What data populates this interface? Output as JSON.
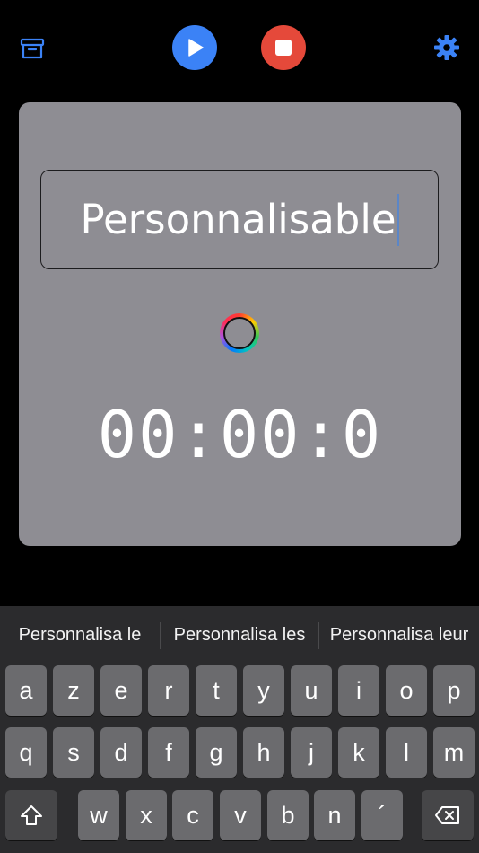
{
  "toolbar": {
    "archive_icon": "archive-box-icon",
    "play_icon": "play-icon",
    "stop_icon": "stop-icon",
    "settings_icon": "gear-icon",
    "accent_color": "#3b82f6",
    "play_color": "#3b82f6",
    "stop_color": "#e5493a"
  },
  "card": {
    "background": "#8e8d93",
    "name_value": "Personnalisable",
    "color_picker_icon": "color-wheel-icon",
    "timer_value": "00:00:0"
  },
  "keyboard": {
    "suggestions": [
      "Personnalisa le",
      "Personnalisa les",
      "Personnalisa leur"
    ],
    "row1": [
      "a",
      "z",
      "e",
      "r",
      "t",
      "y",
      "u",
      "i",
      "o",
      "p"
    ],
    "row2": [
      "q",
      "s",
      "d",
      "f",
      "g",
      "h",
      "j",
      "k",
      "l",
      "m"
    ],
    "row3": [
      "w",
      "x",
      "c",
      "v",
      "b",
      "n",
      "´"
    ],
    "shift_icon": "shift-icon",
    "delete_icon": "backspace-icon"
  }
}
